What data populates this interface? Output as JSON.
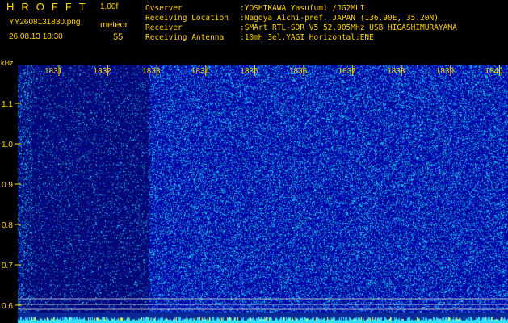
{
  "header": {
    "logo": "HROFFT",
    "version": "1.00f",
    "filename": "YY2608131830.png",
    "meteor_label": "meteor",
    "meteor_count": "55",
    "datetime": "26.08.13 18:30",
    "info": [
      {
        "key": "Ovserver",
        "value": ":YOSHIKAWA Yasufumi /JG2MLI"
      },
      {
        "key": "Receiving Location",
        "value": ":Nagoya Aichi-pref. JAPAN (136.90E, 35.20N)"
      },
      {
        "key": "Receiver",
        "value": ":SMArt RTL-SDR V5 52.905MHz USB HIGASHIMURAYAMA"
      },
      {
        "key": "Receiving Antenna",
        "value": ":10mH 3el.YAGI Horizontal:ENE"
      }
    ]
  },
  "axis": {
    "y_unit": "kHz",
    "minute_ticks": [
      "1831",
      "1832",
      "1833",
      "1834",
      "1835",
      "1836",
      "1837",
      "1838",
      "1839",
      "1840"
    ],
    "freq_ticks": [
      "1.1",
      "1.0",
      "0.9",
      "0.8",
      "0.7",
      "0.6"
    ],
    "freq_values": [
      1.1,
      1.0,
      0.9,
      0.8,
      0.7,
      0.6
    ]
  },
  "colors": {
    "background": "#000000",
    "text": "#ffd400",
    "waterfall": "#1010a0",
    "tick": "#ffd400",
    "guide": "#d0d0d0",
    "baseline": "#30e0ff"
  }
}
